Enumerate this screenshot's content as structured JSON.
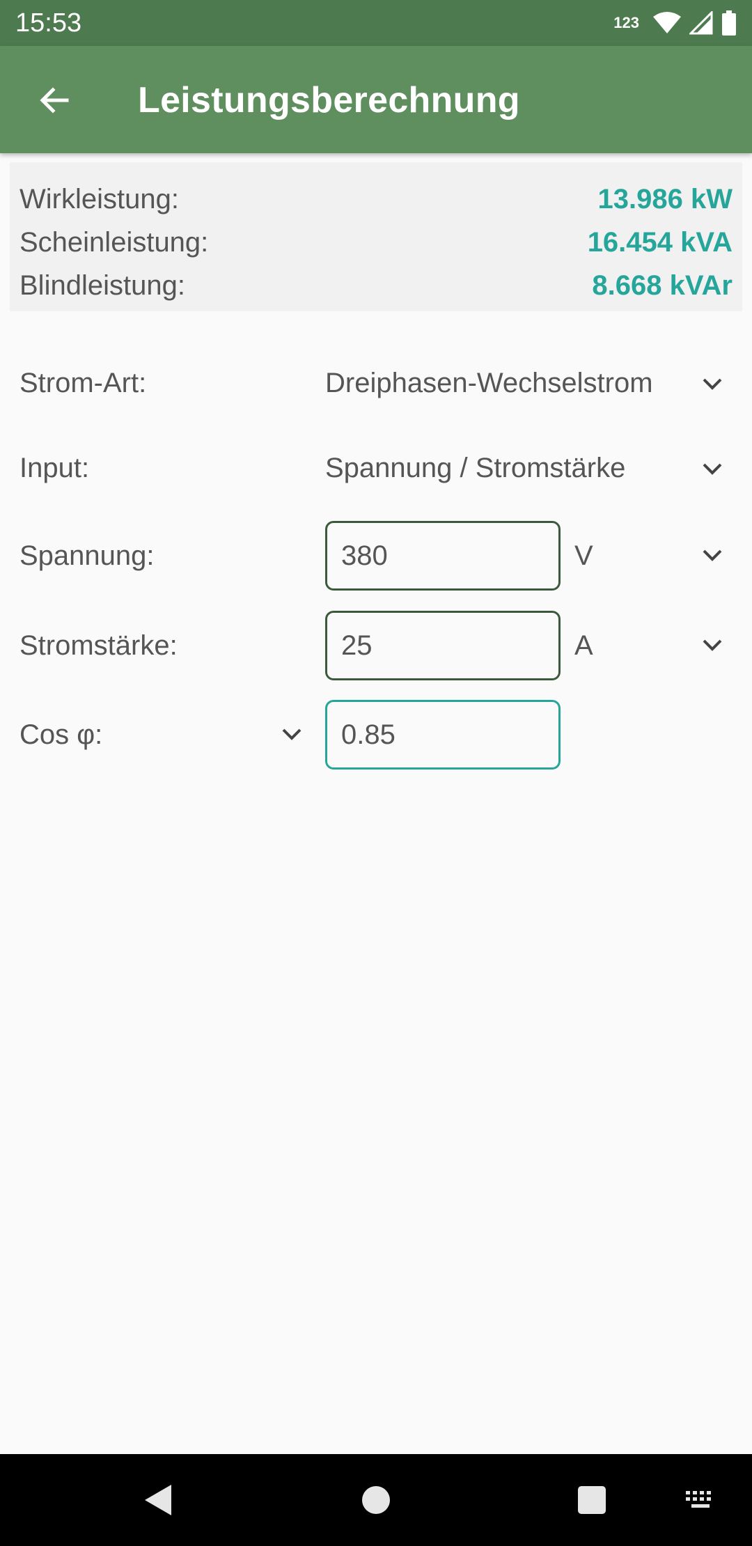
{
  "status_bar": {
    "time": "15:53",
    "indicator": "123",
    "icons": [
      "wifi-icon",
      "signal-icon",
      "battery-icon"
    ]
  },
  "app_bar": {
    "title": "Leistungsberechnung",
    "back_icon": "arrow-back-icon"
  },
  "results": [
    {
      "label": "Wirkleistung:",
      "value": "13.986 kW"
    },
    {
      "label": "Scheinleistung:",
      "value": "16.454 kVA"
    },
    {
      "label": "Blindleistung:",
      "value": "8.668 kVAr"
    }
  ],
  "form": {
    "current_type": {
      "label": "Strom-Art:",
      "value": "Dreiphasen-Wechselstrom"
    },
    "input": {
      "label": "Input:",
      "value": "Spannung / Stromstärke"
    },
    "voltage": {
      "label": "Spannung:",
      "value": "380",
      "unit": "V"
    },
    "current": {
      "label": "Stromstärke:",
      "value": "25",
      "unit": "A"
    },
    "cos_phi": {
      "label": "Cos φ:",
      "value": "0.85"
    }
  },
  "nav_bar": {
    "buttons": [
      "back-triangle-icon",
      "home-circle-icon",
      "recents-square-icon",
      "keyboard-icon"
    ]
  },
  "colors": {
    "status_bar": "#4d7a4e",
    "app_bar": "#5f8f5e",
    "result_value": "#26a69a",
    "field_border": "#3b5a3c",
    "field_focus": "#26a69a"
  }
}
